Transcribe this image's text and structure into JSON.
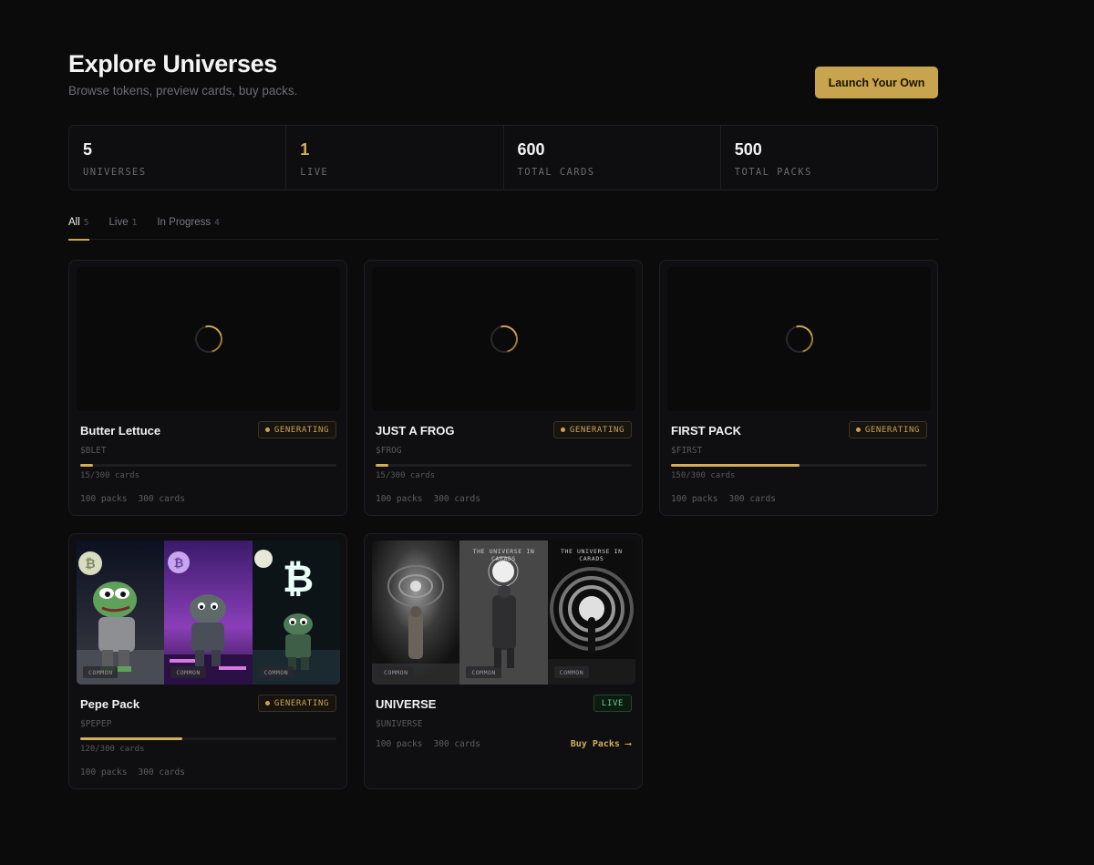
{
  "header": {
    "title": "Explore Universes",
    "subtitle": "Browse tokens, preview cards, buy packs.",
    "launch_label": "Launch Your Own"
  },
  "stats": [
    {
      "value": "5",
      "label": "UNIVERSES"
    },
    {
      "value": "1",
      "label": "LIVE"
    },
    {
      "value": "600",
      "label": "TOTAL CARDS"
    },
    {
      "value": "500",
      "label": "TOTAL PACKS"
    }
  ],
  "tabs": [
    {
      "label": "All",
      "count": "5"
    },
    {
      "label": "Live",
      "count": "1"
    },
    {
      "label": "In Progress",
      "count": "4"
    }
  ],
  "colors": {
    "accent": "#c9a44e",
    "live": "#5fd38a",
    "background": "#0b0b0c"
  },
  "cards": [
    {
      "name": "Butter Lettuce",
      "ticker": "$BLET",
      "status": "GENERATING",
      "progress_text": "15/300 cards",
      "progress": 0.05,
      "packs": "100 packs",
      "cards": "300 cards"
    },
    {
      "name": "JUST A FROG",
      "ticker": "$FROG",
      "status": "GENERATING",
      "progress_text": "15/300 cards",
      "progress": 0.05,
      "packs": "100 packs",
      "cards": "300 cards"
    },
    {
      "name": "FIRST PACK",
      "ticker": "$FIRST",
      "status": "GENERATING",
      "progress_text": "150/300 cards",
      "progress": 0.5,
      "packs": "100 packs",
      "cards": "300 cards"
    },
    {
      "name": "Pepe Pack",
      "ticker": "$PEPEP",
      "status": "GENERATING",
      "progress_text": "120/300 cards",
      "progress": 0.4,
      "packs": "100 packs",
      "cards": "300 cards",
      "rarities": [
        "COMMON",
        "COMMON",
        "COMMON"
      ]
    },
    {
      "name": "UNIVERSE",
      "ticker": "$UNIVERSE",
      "status": "LIVE",
      "packs": "100 packs",
      "cards": "300 cards",
      "buy_label": "Buy Packs ⟶",
      "rarities": [
        "COMMON",
        "COMMON",
        "COMMON"
      ],
      "panel_captions": [
        "",
        "THE UNIVERSE IN CARADS",
        "THE UNIVERSE IN CARADS"
      ]
    }
  ]
}
